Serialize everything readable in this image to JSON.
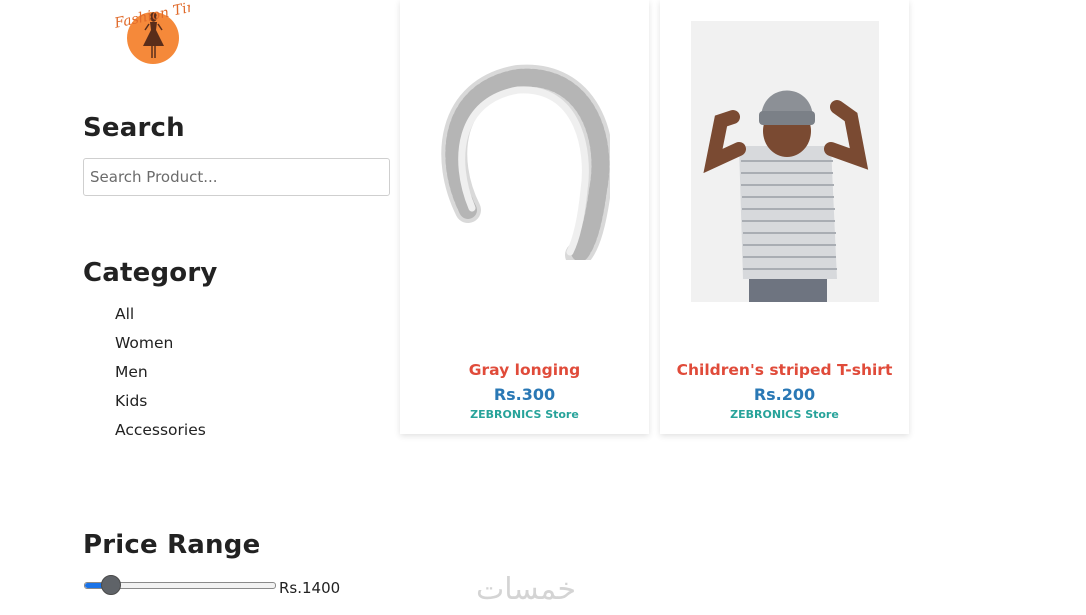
{
  "brand": {
    "logo_text": "Fashion Time",
    "accent_color": "#f5893a"
  },
  "search": {
    "heading": "Search",
    "placeholder": "Search Product...",
    "value": ""
  },
  "category": {
    "heading": "Category",
    "items": [
      {
        "label": "All"
      },
      {
        "label": "Women"
      },
      {
        "label": "Men"
      },
      {
        "label": "Kids"
      },
      {
        "label": "Accessories"
      }
    ]
  },
  "price_range": {
    "heading": "Price Range",
    "value_label": "Rs.1400",
    "fill_fraction": 0.13
  },
  "products": [
    {
      "title": "Gray longing",
      "price": "Rs.300",
      "store": "ZEBRONICS Store",
      "image": "headband-photo"
    },
    {
      "title": "Children's striped T-shirt",
      "price": "Rs.200",
      "store": "ZEBRONICS Store",
      "image": "child-photo"
    }
  ],
  "colors": {
    "title": "#e04b3a",
    "price": "#2a78b5",
    "store": "#27a39a"
  },
  "watermark": "خمسات"
}
